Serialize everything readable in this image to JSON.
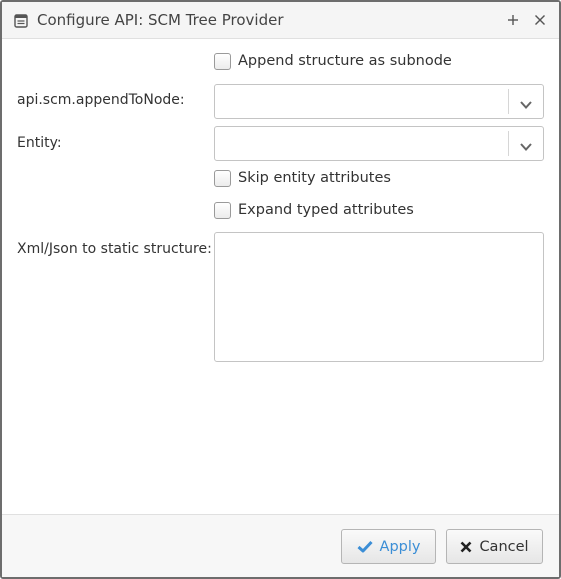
{
  "window": {
    "title": "Configure API: SCM Tree Provider",
    "title_icon": "dialog-window-icon",
    "maximize_icon": "plus-icon",
    "close_icon": "close-icon"
  },
  "form": {
    "append_structure": {
      "label": "Append structure as subnode",
      "checked": false
    },
    "append_to_node": {
      "label": "api.scm.appendToNode:",
      "value": ""
    },
    "entity": {
      "label": "Entity:",
      "value": ""
    },
    "skip_entity_attributes": {
      "label": "Skip entity attributes",
      "checked": false
    },
    "expand_typed_attributes": {
      "label": "Expand typed attributes",
      "checked": false
    },
    "static_structure": {
      "label": "Xml/Json to static structure:",
      "value": ""
    }
  },
  "footer": {
    "apply_label": "Apply",
    "apply_icon": "checkmark-icon",
    "cancel_label": "Cancel",
    "cancel_icon": "x-icon"
  },
  "colors": {
    "accent": "#3b8ed6",
    "border": "#6d6d6d"
  }
}
